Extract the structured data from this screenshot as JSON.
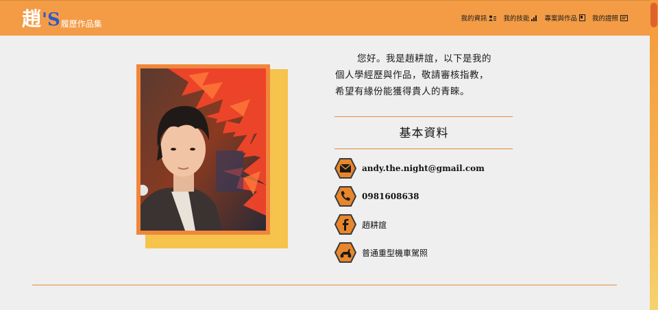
{
  "brand": {
    "main": "趙",
    "apostrophe_s": "'S",
    "subtitle": "履歷作品集"
  },
  "nav": {
    "items": [
      {
        "label": "我的資訊",
        "icon": "user-list-icon"
      },
      {
        "label": "我的技能",
        "icon": "signal-bars-icon"
      },
      {
        "label": "專案與作品",
        "icon": "file-icon"
      },
      {
        "label": "我的證照",
        "icon": "certificate-icon"
      }
    ]
  },
  "intro": {
    "line1": "您好。我是趙耕誼，以下是我的",
    "line2": "個人學經歷與作品，敬請審核指教，",
    "line3": "希望有緣份能獲得貴人的青睞。"
  },
  "basic_info": {
    "title": "基本資料",
    "items": [
      {
        "icon": "envelope-icon",
        "text": "andy.the.night@gmail.com"
      },
      {
        "icon": "phone-icon",
        "text": "0981608638"
      },
      {
        "icon": "facebook-icon",
        "text": "趙耕誼"
      },
      {
        "icon": "scooter-icon",
        "text": "普通重型機車駕照"
      }
    ]
  },
  "colors": {
    "navbar": "#f39c45",
    "accent": "#e48a37",
    "frame_shadow": "#f6c34c",
    "hex_icon": "#e8862c"
  }
}
